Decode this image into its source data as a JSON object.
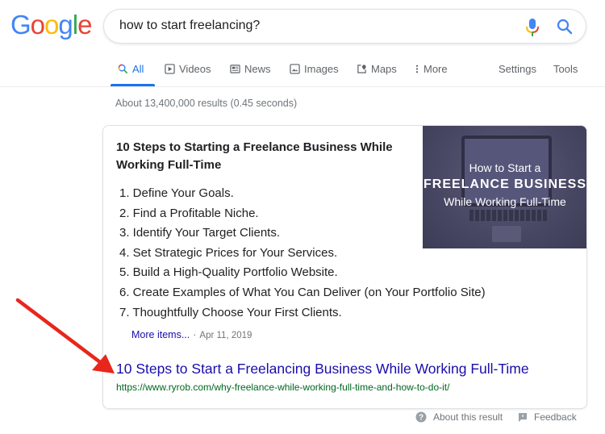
{
  "logo": {
    "letters": [
      "G",
      "o",
      "o",
      "g",
      "l",
      "e"
    ],
    "colors": [
      "#4285f4",
      "#ea4335",
      "#fbbc05",
      "#4285f4",
      "#34a853",
      "#ea4335"
    ]
  },
  "search": {
    "query": "how to start freelancing?"
  },
  "tabs": [
    {
      "label": "All",
      "icon": "search-icon",
      "active": true
    },
    {
      "label": "Videos",
      "icon": "play-icon"
    },
    {
      "label": "News",
      "icon": "newspaper-icon"
    },
    {
      "label": "Images",
      "icon": "image-icon"
    },
    {
      "label": "Maps",
      "icon": "map-pin-icon"
    },
    {
      "label": "More",
      "icon": "more-vert-icon"
    }
  ],
  "tools": {
    "settings": "Settings",
    "tools": "Tools"
  },
  "result_stats": "About 13,400,000 results (0.45 seconds)",
  "featured_snippet": {
    "title": "10 Steps to Starting a Freelance Business While Working Full-Time",
    "steps": [
      "1. Define Your Goals.",
      "2. Find a Profitable Niche.",
      "3. Identify Your Target Clients.",
      "4. Set Strategic Prices for Your Services.",
      "5. Build a High-Quality Portfolio Website.",
      "6. Create Examples of What You Can Deliver (on Your Portfolio Site)",
      "7. Thoughtfully Choose Your First Clients."
    ],
    "more_items": "More items...",
    "separator": "·",
    "date": "Apr 11, 2019",
    "thumbnail": {
      "line1": "How to Start a",
      "line2": "FREELANCE BUSINESS",
      "line3": "While Working Full-Time"
    },
    "source_title": "10 Steps to Start a Freelancing Business While Working Full-Time",
    "source_url": "https://www.ryrob.com/why-freelance-while-working-full-time-and-how-to-do-it/"
  },
  "footer": {
    "about": "About this result",
    "feedback": "Feedback"
  },
  "colors": {
    "link": "#1a0dab",
    "url": "#006621",
    "accent": "#1a73e8",
    "annotation_arrow": "#e8261c"
  }
}
